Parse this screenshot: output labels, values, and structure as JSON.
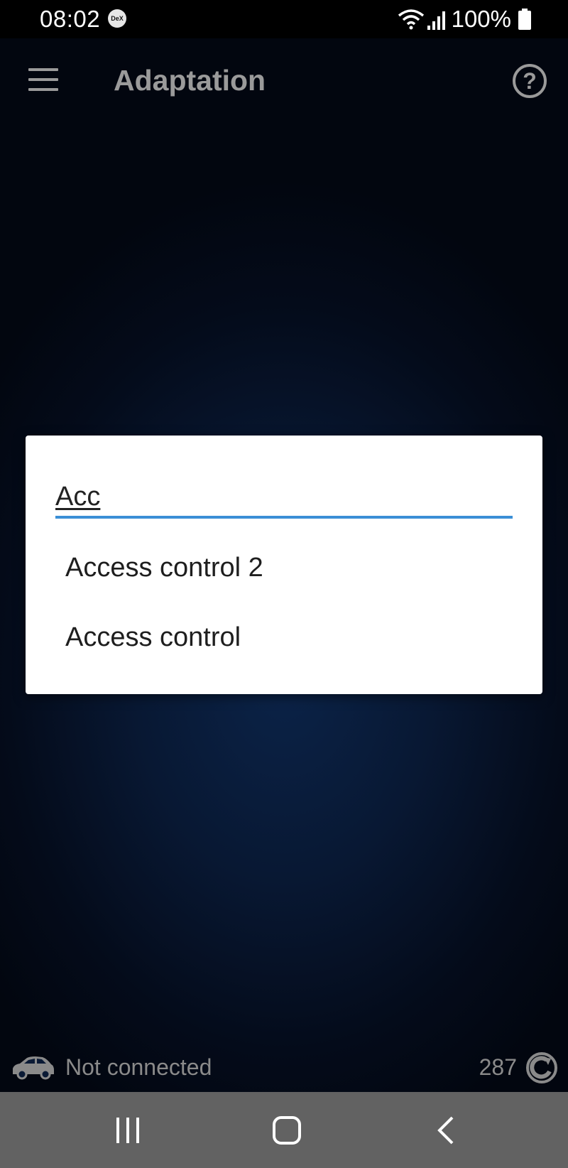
{
  "status_bar": {
    "time": "08:02",
    "dex_badge": "DeX",
    "battery": "100%"
  },
  "app_bar": {
    "title": "Adaptation"
  },
  "dialog": {
    "search_value": "Acc",
    "options": [
      "Access control 2",
      "Access control"
    ]
  },
  "bottom": {
    "connection_status": "Not connected",
    "count": "287"
  },
  "colors": {
    "accent": "#3b8fd6",
    "background": "#081833",
    "nav_bar": "#626262"
  },
  "icons": {
    "menu": "hamburger-menu-icon",
    "help": "question-circle-icon",
    "car": "car-icon",
    "refresh": "refresh-icon",
    "nav_recents": "recents-icon",
    "nav_home": "home-icon",
    "nav_back": "back-icon"
  }
}
